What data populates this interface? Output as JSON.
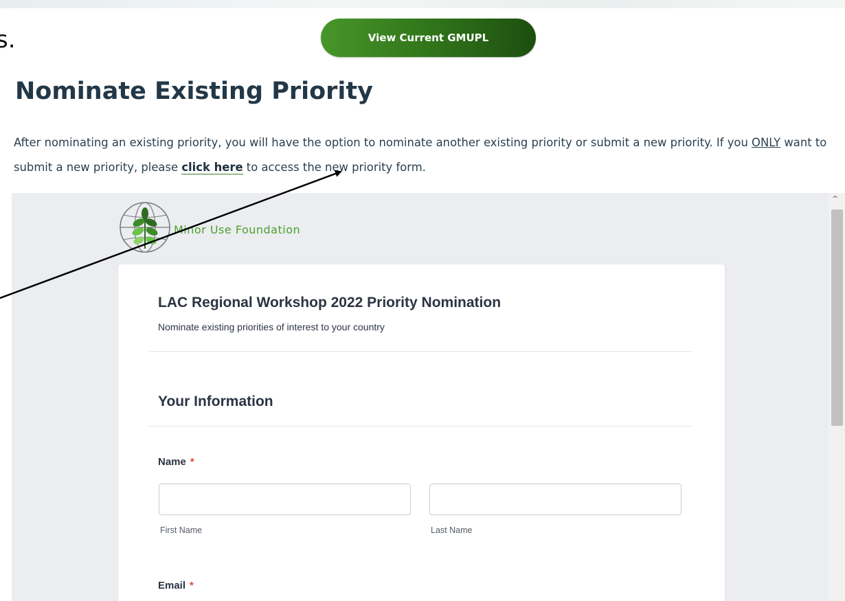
{
  "header": {
    "clipped_text": "s.",
    "gmupl_button_label": "View Current GMUPL"
  },
  "page": {
    "title": "Nominate Existing Priority",
    "intro_before": "After nominating an existing priority, you will have the option to nominate another existing priority or submit a new priority. If you ",
    "intro_only": "ONLY",
    "intro_middle": " want to submit a new priority, please ",
    "intro_link": "click here",
    "intro_after": " to access the new priority form."
  },
  "embed": {
    "logo_text": "Minor Use Foundation",
    "form_title": "LAC Regional Workshop 2022 Priority Nomination",
    "form_subtitle": "Nominate existing priorities of interest to your country",
    "section_title": "Your Information",
    "name_label": "Name",
    "required_marker": "*",
    "first_name_value": "",
    "last_name_value": "",
    "first_name_sublabel": "First Name",
    "last_name_sublabel": "Last Name",
    "email_label": "Email",
    "scroll_up_glyph": "^"
  },
  "colors": {
    "button_green": "#2f7219",
    "title_navy": "#233847",
    "logo_green": "#4aa02c",
    "required_red": "#e0443c"
  },
  "icons": [
    "globe-leaf-logo-icon",
    "annotation-arrow-icon",
    "scroll-up-icon"
  ]
}
